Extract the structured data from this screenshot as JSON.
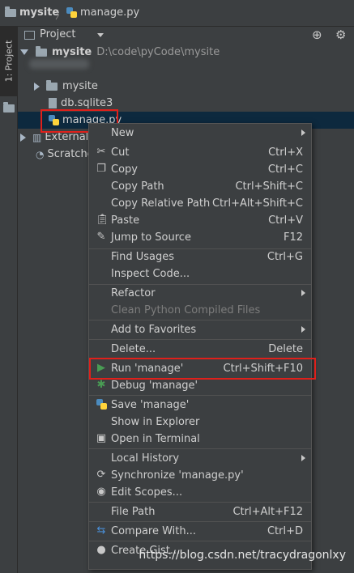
{
  "breadcrumb": {
    "project": "mysite",
    "file": "manage.py"
  },
  "toolstrip": {
    "tab_label": "1: Project"
  },
  "project_panel": {
    "title": "Project"
  },
  "tree": {
    "root": {
      "name": "mysite",
      "path": "D:\\code\\pyCode\\mysite"
    },
    "items": [
      {
        "label": "mysite"
      },
      {
        "label": "db.sqlite3"
      },
      {
        "label": "manage.py"
      },
      {
        "label": "External L"
      },
      {
        "label": "Scratches"
      }
    ]
  },
  "context_menu": {
    "items": [
      {
        "label": "New",
        "shortcut": ""
      },
      {
        "label": "Cut",
        "shortcut": "Ctrl+X"
      },
      {
        "label": "Copy",
        "shortcut": "Ctrl+C"
      },
      {
        "label": "Copy Path",
        "shortcut": "Ctrl+Shift+C"
      },
      {
        "label": "Copy Relative Path",
        "shortcut": "Ctrl+Alt+Shift+C"
      },
      {
        "label": "Paste",
        "shortcut": "Ctrl+V"
      },
      {
        "label": "Jump to Source",
        "shortcut": "F12"
      },
      {
        "label": "Find Usages",
        "shortcut": "Ctrl+G"
      },
      {
        "label": "Inspect Code...",
        "shortcut": ""
      },
      {
        "label": "Refactor",
        "shortcut": ""
      },
      {
        "label": "Clean Python Compiled Files",
        "shortcut": ""
      },
      {
        "label": "Add to Favorites",
        "shortcut": ""
      },
      {
        "label": "Delete...",
        "shortcut": "Delete"
      },
      {
        "label": "Run 'manage'",
        "shortcut": "Ctrl+Shift+F10"
      },
      {
        "label": "Debug 'manage'",
        "shortcut": ""
      },
      {
        "label": "Save 'manage'",
        "shortcut": ""
      },
      {
        "label": "Show in Explorer",
        "shortcut": ""
      },
      {
        "label": "Open in Terminal",
        "shortcut": ""
      },
      {
        "label": "Local History",
        "shortcut": ""
      },
      {
        "label": "Synchronize 'manage.py'",
        "shortcut": ""
      },
      {
        "label": "Edit Scopes...",
        "shortcut": ""
      },
      {
        "label": "File Path",
        "shortcut": "Ctrl+Alt+F12"
      },
      {
        "label": "Compare With...",
        "shortcut": "Ctrl+D"
      },
      {
        "label": "Create Gist...",
        "shortcut": ""
      }
    ]
  },
  "watermark": "https://blog.csdn.net/tracydragonlxy",
  "colors": {
    "selection": "#0d293e",
    "highlight_box": "#e0201b",
    "run_icon": "#499c54"
  }
}
